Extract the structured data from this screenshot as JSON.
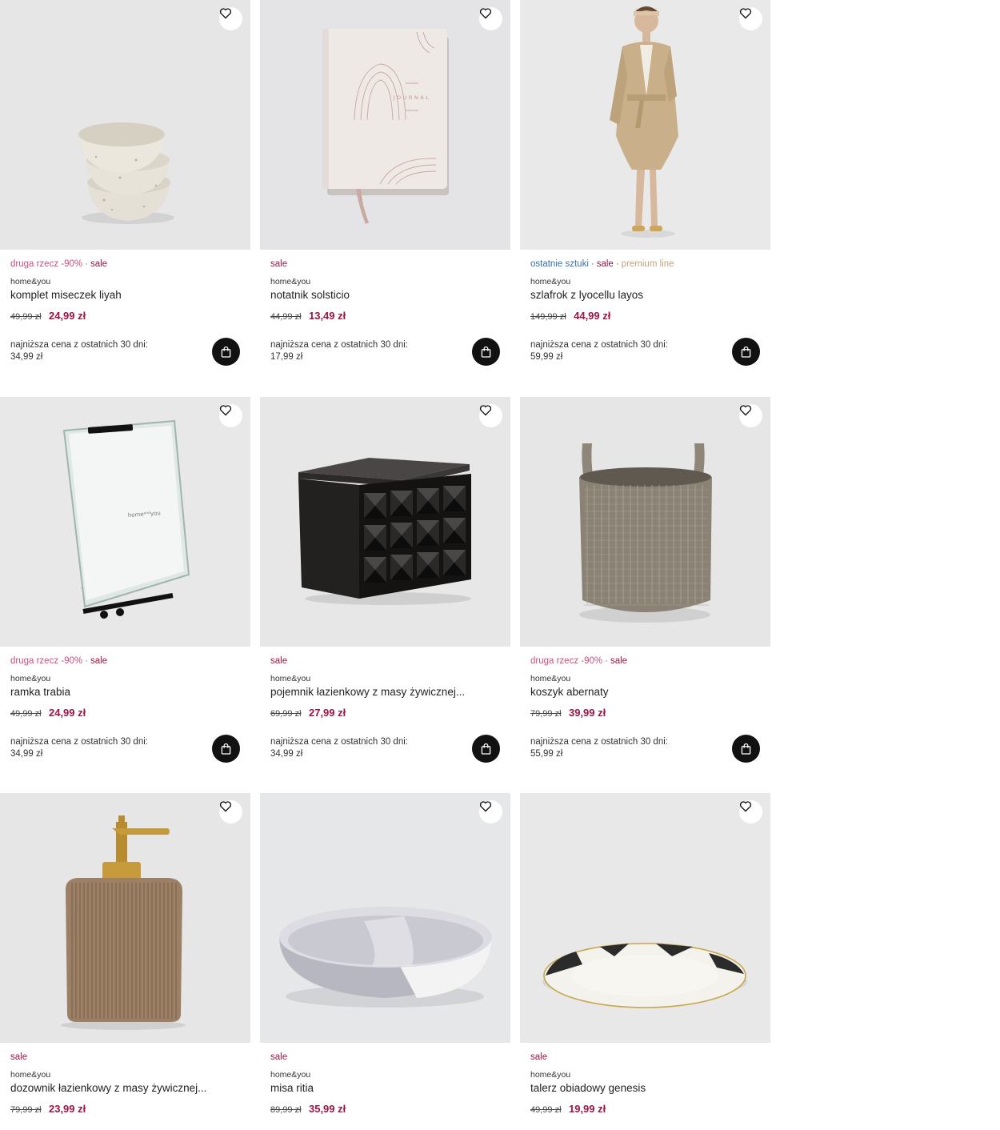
{
  "products": [
    {
      "tags": [
        {
          "text": "druga rzecz -90%",
          "kind": "promo"
        },
        {
          "text": "sale",
          "kind": "sale"
        }
      ],
      "brand": "home&you",
      "name": "komplet miseczek liyah",
      "old_price": "49,99 zł",
      "new_price": "24,99 zł",
      "lowest_label": "najniższa cena z ostatnich 30 dni:",
      "lowest_price": "34,99 zł",
      "image": "bowls"
    },
    {
      "tags": [
        {
          "text": "sale",
          "kind": "sale"
        }
      ],
      "brand": "home&you",
      "name": "notatnik solsticio",
      "old_price": "44,99 zł",
      "new_price": "13,49 zł",
      "lowest_label": "najniższa cena z ostatnich 30 dni:",
      "lowest_price": "17,99 zł",
      "image": "journal",
      "image_text": "JOURNAL"
    },
    {
      "tags": [
        {
          "text": "ostatnie sztuki",
          "kind": "last"
        },
        {
          "text": "sale",
          "kind": "sale"
        },
        {
          "text": "premium line",
          "kind": "premium"
        }
      ],
      "brand": "home&you",
      "name": "szlafrok z lyocellu layos",
      "old_price": "149,99 zł",
      "new_price": "44,99 zł",
      "lowest_label": "najniższa cena z ostatnich 30 dni:",
      "lowest_price": "59,99 zł",
      "image": "robe"
    },
    {
      "tags": [
        {
          "text": "druga rzecz -90%",
          "kind": "promo"
        },
        {
          "text": "sale",
          "kind": "sale"
        }
      ],
      "brand": "home&you",
      "name": "ramka trabia",
      "old_price": "49,99 zł",
      "new_price": "24,99 zł",
      "lowest_label": "najniższa cena z ostatnich 30 dni:",
      "lowest_price": "34,99 zł",
      "image": "frame"
    },
    {
      "tags": [
        {
          "text": "sale",
          "kind": "sale"
        }
      ],
      "brand": "home&you",
      "name": "pojemnik łazienkowy z masy żywicznej...",
      "old_price": "69,99 zł",
      "new_price": "27,99 zł",
      "lowest_label": "najniższa cena z ostatnich 30 dni:",
      "lowest_price": "34,99 zł",
      "image": "box"
    },
    {
      "tags": [
        {
          "text": "druga rzecz -90%",
          "kind": "promo"
        },
        {
          "text": "sale",
          "kind": "sale"
        }
      ],
      "brand": "home&you",
      "name": "koszyk abernaty",
      "old_price": "79,99 zł",
      "new_price": "39,99 zł",
      "lowest_label": "najniższa cena z ostatnich 30 dni:",
      "lowest_price": "55,99 zł",
      "image": "basket"
    },
    {
      "tags": [
        {
          "text": "sale",
          "kind": "sale"
        }
      ],
      "brand": "home&you",
      "name": "dozownik łazienkowy z masy żywicznej...",
      "old_price": "79,99 zł",
      "new_price": "23,99 zł",
      "image": "dispenser"
    },
    {
      "tags": [
        {
          "text": "sale",
          "kind": "sale"
        }
      ],
      "brand": "home&you",
      "name": "misa ritia",
      "old_price": "89,99 zł",
      "new_price": "35,99 zł",
      "image": "bowl"
    },
    {
      "tags": [
        {
          "text": "sale",
          "kind": "sale"
        }
      ],
      "brand": "home&you",
      "name": "talerz obiadowy genesis",
      "old_price": "49,99 zł",
      "new_price": "19,99 zł",
      "image": "plate"
    }
  ],
  "icons": {
    "favorite": "heart-outline-icon",
    "cart": "shopping-bag-icon"
  },
  "colors": {
    "sale": "#9a1546",
    "promo": "#c94f7f",
    "last_items": "#3a6fa8",
    "premium": "#c2a27c",
    "cart_button": "#111111"
  }
}
